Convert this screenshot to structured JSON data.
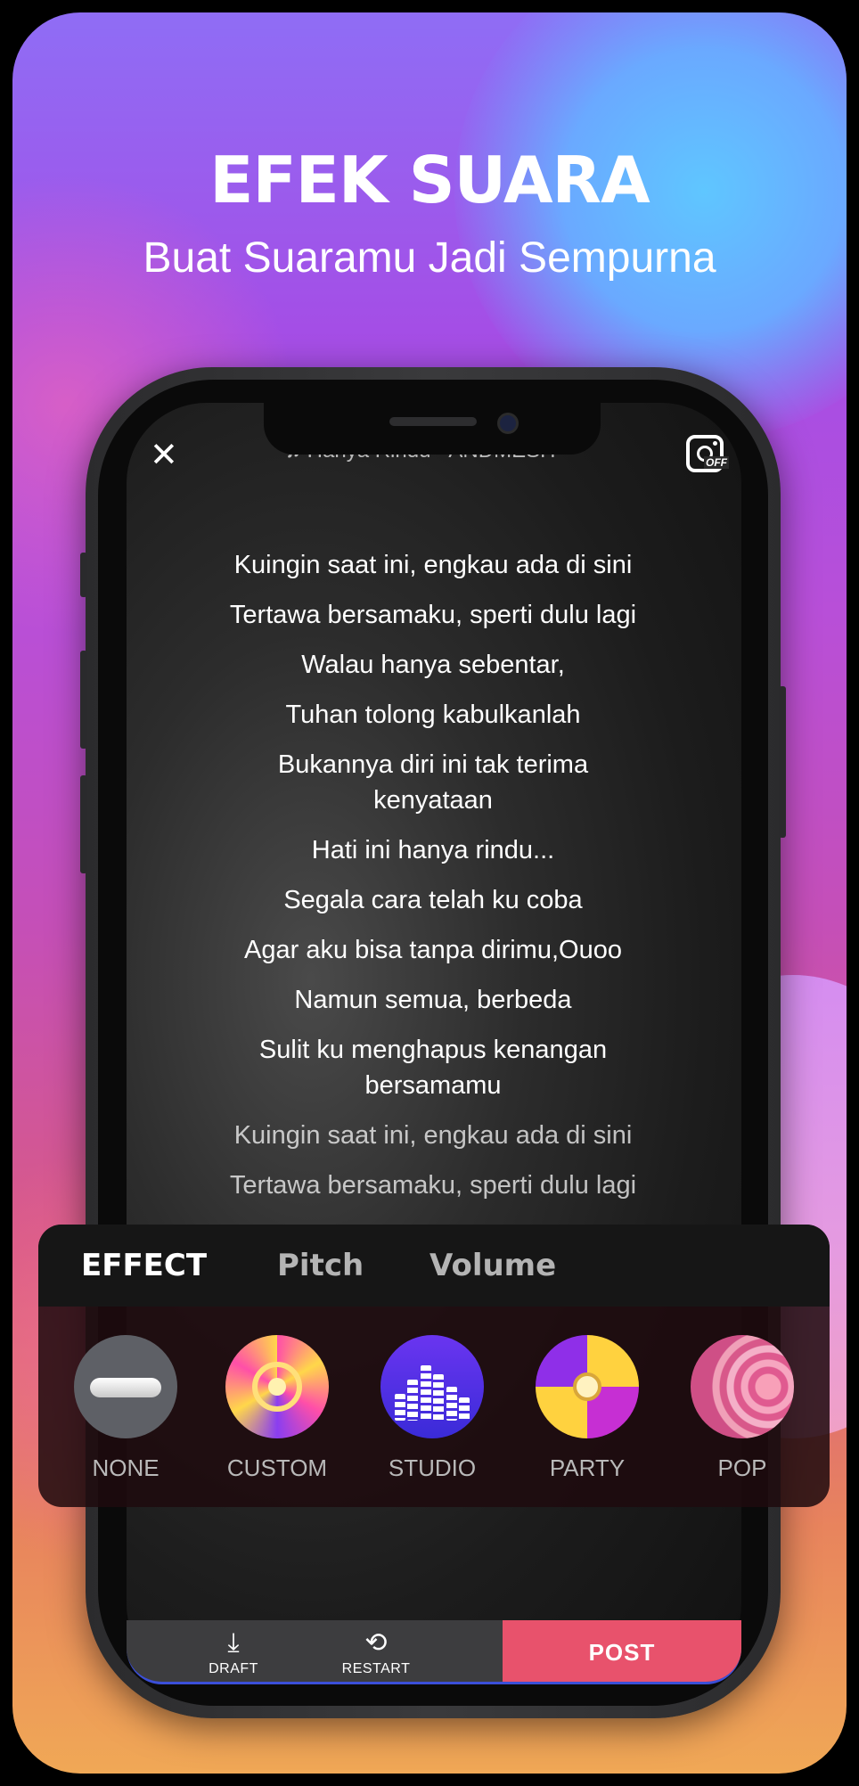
{
  "promo": {
    "headline": "EFEK SUARA",
    "subline": "Buat Suaramu Jadi Sempurna"
  },
  "top_bar": {
    "close_icon": "close-icon",
    "song_title": "Hanya Rindu - ANDMESH",
    "camera_toggle_icon": "instagram-camera-icon",
    "camera_toggle_state": "OFF"
  },
  "lyrics": [
    "Kuingin saat ini, engkau ada di sini",
    "Tertawa bersamaku, sperti dulu lagi",
    "Walau hanya sebentar,",
    "Tuhan tolong kabulkanlah",
    "Bukannya diri ini tak terima kenyataan",
    "Hati ini hanya rindu...",
    "Segala cara telah ku coba",
    "Agar aku bisa tanpa dirimu,Ouoo",
    "Namun semua, berbeda",
    "Sulit ku menghapus kenangan bersamamu",
    "Kuingin saat ini, engkau ada di sini",
    "Tertawa bersamaku, sperti dulu lagi"
  ],
  "effect_panel": {
    "tabs": [
      "EFFECT",
      "Pitch",
      "Volume"
    ],
    "active_tab": "EFFECT",
    "effects": [
      {
        "label": "NONE",
        "icon": "none-effect-icon"
      },
      {
        "label": "CUSTOM",
        "icon": "custom-effect-icon"
      },
      {
        "label": "STUDIO",
        "icon": "studio-effect-icon"
      },
      {
        "label": "PARTY",
        "icon": "party-effect-icon"
      },
      {
        "label": "POP",
        "icon": "pop-effect-icon"
      }
    ]
  },
  "bottom_bar": {
    "draft_label": "DRAFT",
    "restart_label": "RESTART",
    "post_label": "POST",
    "post_color": "#e8526c"
  }
}
